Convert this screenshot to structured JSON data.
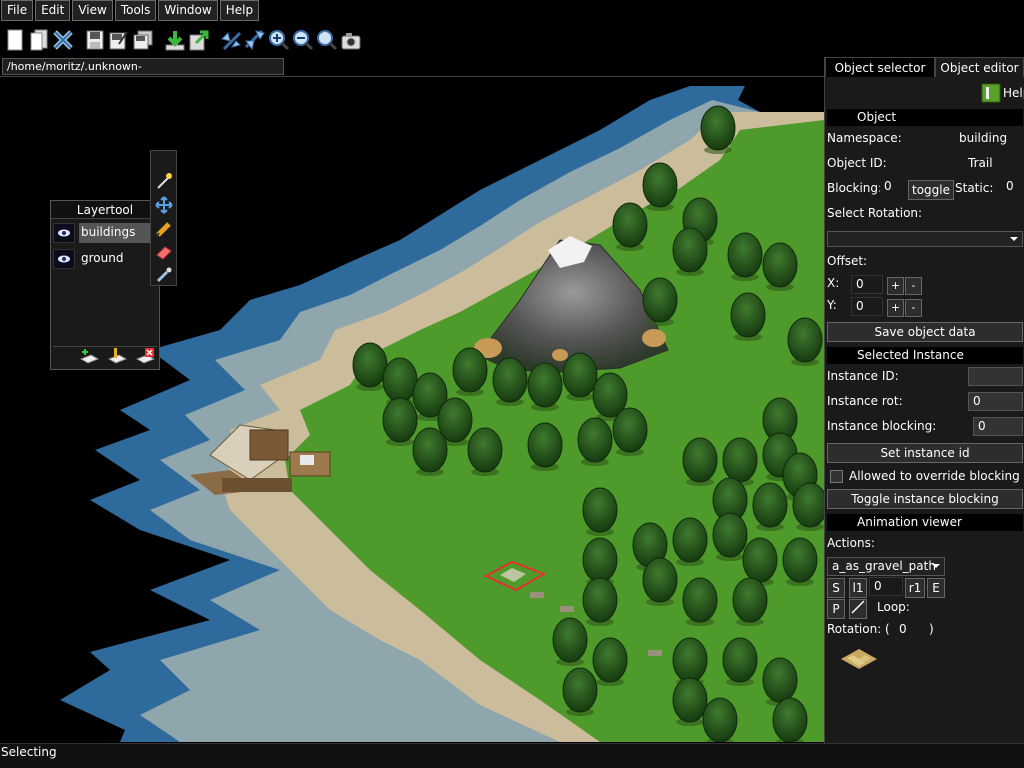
{
  "menu": [
    "File",
    "Edit",
    "View",
    "Tools",
    "Window",
    "Help"
  ],
  "toolbar": {
    "icons": [
      "new-file-icon",
      "open-file-icon",
      "close-file-icon",
      "save-icon",
      "save-as-icon",
      "save-all-icon",
      "import-icon",
      "export-icon",
      "rotate-left-icon",
      "rotate-right-icon",
      "zoom-in-icon",
      "zoom-out-icon",
      "zoom-reset-icon",
      "screenshot-icon"
    ]
  },
  "path": "/home/moritz/.unknown-horizons/save/sspiel.sqlite",
  "layertool": {
    "title": "Layertool",
    "layers": [
      {
        "name": "buildings",
        "selected": true
      },
      {
        "name": "ground",
        "selected": false
      }
    ]
  },
  "tool_palette": {
    "icons": [
      "select-tool-icon",
      "move-tool-icon",
      "pencil-tool-icon",
      "eraser-tool-icon",
      "eyedropper-tool-icon"
    ]
  },
  "panel": {
    "tabs": [
      "Object selector",
      "Object editor"
    ],
    "active_tab": "Object editor",
    "help": "Help",
    "object": {
      "header": "Object",
      "namespace_label": "Namespace:",
      "namespace": "building",
      "object_id_label": "Object ID:",
      "object_id": "Trail",
      "blocking_label": "Blocking:",
      "blocking": "0",
      "toggle": "toggle",
      "static_label": "Static:",
      "static": "0",
      "rotation_label": "Select Rotation:",
      "rotation": "",
      "offset_label": "Offset:",
      "x_label": "X:",
      "x": "0",
      "y_label": "Y:",
      "y": "0",
      "plus": "+",
      "minus": "-",
      "save": "Save object data"
    },
    "instance": {
      "header": "Selected Instance",
      "id_label": "Instance ID:",
      "id": "",
      "rot_label": "Instance rot:",
      "rot": "0",
      "blocking_label": "Instance blocking:",
      "blocking": "0",
      "set_id": "Set instance id",
      "override_label": "Allowed to override blocking",
      "toggle_blocking": "Toggle instance blocking"
    },
    "animation": {
      "header": "Animation viewer",
      "actions_label": "Actions:",
      "action": "a_as_gravel_path",
      "btn_s": "S",
      "btn_l1": "l1",
      "frame": "0",
      "btn_r1": "r1",
      "btn_e": "E",
      "btn_p": "P",
      "loop_label": "Loop:",
      "rotation_label": "Rotation: (",
      "rotation_value": "0",
      "rotation_close": ")"
    }
  },
  "status": "Selecting",
  "colors": {
    "water": "#3a78a8",
    "shallow": "#9fb2b7",
    "sand": "#c8b896",
    "grass": "#4f9a2a",
    "tree": "#1e4a16",
    "mountain": "#5a5a5a"
  }
}
